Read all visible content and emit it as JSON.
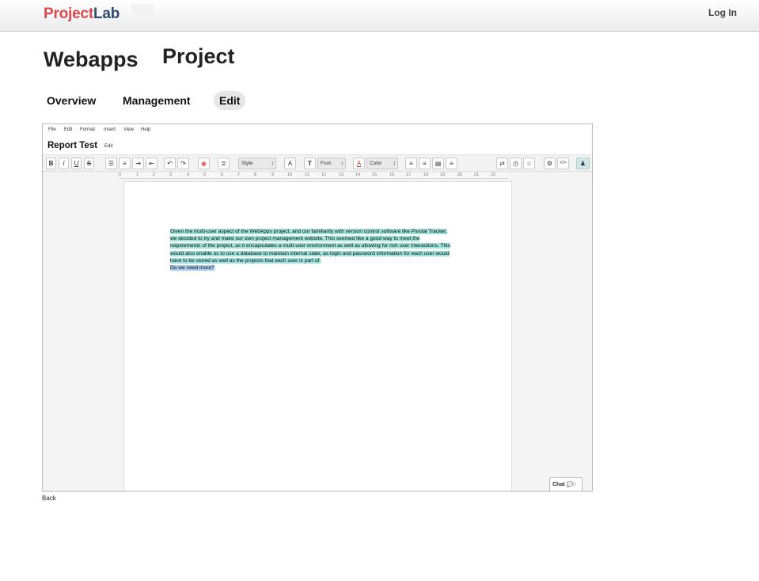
{
  "header": {
    "logo_part1": "Project",
    "logo_part2": "Lab",
    "login_label": "Log In"
  },
  "page": {
    "title_word1": "Webapps",
    "title_word2": "Project"
  },
  "tabs": [
    {
      "label": "Overview"
    },
    {
      "label": "Management"
    },
    {
      "label": "Edit",
      "active": true
    }
  ],
  "editor": {
    "menu": [
      "File",
      "Edit",
      "Format",
      "Insert",
      "View",
      "Help"
    ],
    "doc_title": "Report Test",
    "doc_edit_label": "Edit",
    "toolbar": {
      "style_select": "Style",
      "font_select": "Font",
      "color_select": "Color"
    },
    "ruler_ticks": [
      "0",
      "1",
      "2",
      "3",
      "4",
      "5",
      "6",
      "7",
      "8",
      "9",
      "10",
      "11",
      "12",
      "13",
      "14",
      "15",
      "16",
      "17",
      "18",
      "19",
      "20",
      "21",
      "22"
    ],
    "body_lines": [
      "Given the multi-user aspect of the WebApps project, and our familiarity with version control software like Pivotal Tracker,",
      "we decided to try and make our own project management website. This seemed like a good way to meet the",
      "requirements of the project, as it encapsulates a multi-user environment as well as allowing for rich user interactions. This",
      "would also enable us to use a database to maintain internal state, as login and password information for each user would",
      "have to be stored as well as the projects that each user is part of."
    ],
    "body_question": "Do we need more?",
    "chat_label": "Chat",
    "chat_count": "0",
    "colors": {
      "highlight": "#9ee3dc",
      "selection": "#a8cdf0",
      "logo_red": "#e0474c",
      "logo_blue": "#2c4a6e"
    }
  },
  "footer": {
    "back_label": "Back"
  }
}
